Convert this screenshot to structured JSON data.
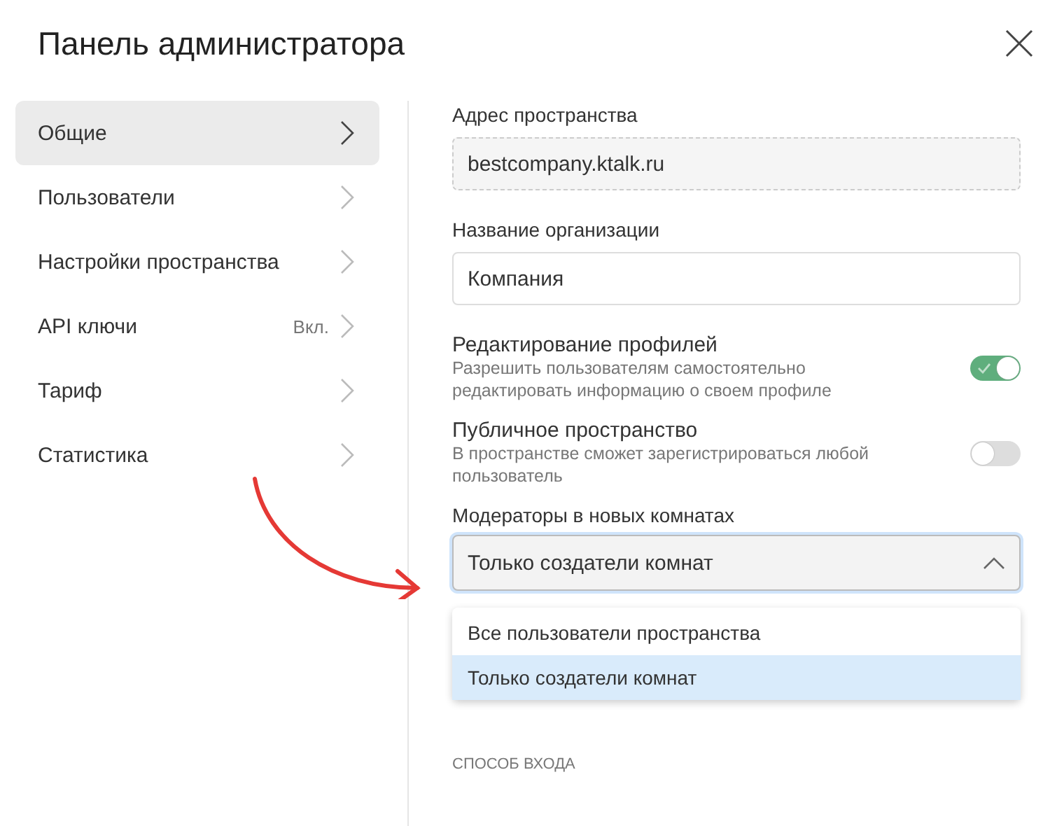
{
  "window": {
    "title": "Панель администратора"
  },
  "sidebar": {
    "items": [
      {
        "label": "Общие",
        "selected": true
      },
      {
        "label": "Пользователи",
        "selected": false
      },
      {
        "label": "Настройки пространства",
        "selected": false
      },
      {
        "label": "API ключи",
        "badge": "Вкл.",
        "selected": false
      },
      {
        "label": "Тариф",
        "selected": false
      },
      {
        "label": "Статистика",
        "selected": false
      }
    ]
  },
  "fields": [
    {
      "label": "Адрес пространства",
      "value": "bestcompany.ktalk.ru",
      "disabled": true
    },
    {
      "label": "Название организации",
      "value": "Компания",
      "disabled": false
    }
  ],
  "toggles": [
    {
      "title": "Редактирование профилей",
      "description": "Разрешить пользователям самостоятельно редактировать информацию о своем профиле",
      "on": true
    },
    {
      "title": "Публичное пространство",
      "description": "В пространстве сможет зарегистрироваться любой пользователь",
      "on": false
    }
  ],
  "select": {
    "label": "Модераторы в новых комнатах",
    "value": "Только создатели комнат",
    "expanded": true,
    "options": [
      {
        "label": "Все пользователи пространства",
        "selected": false
      },
      {
        "label": "Только создатели комнат",
        "selected": true
      }
    ]
  },
  "section": {
    "title": "СПОСОБ ВХОДА"
  },
  "annotation": {
    "kind": "arrow"
  }
}
